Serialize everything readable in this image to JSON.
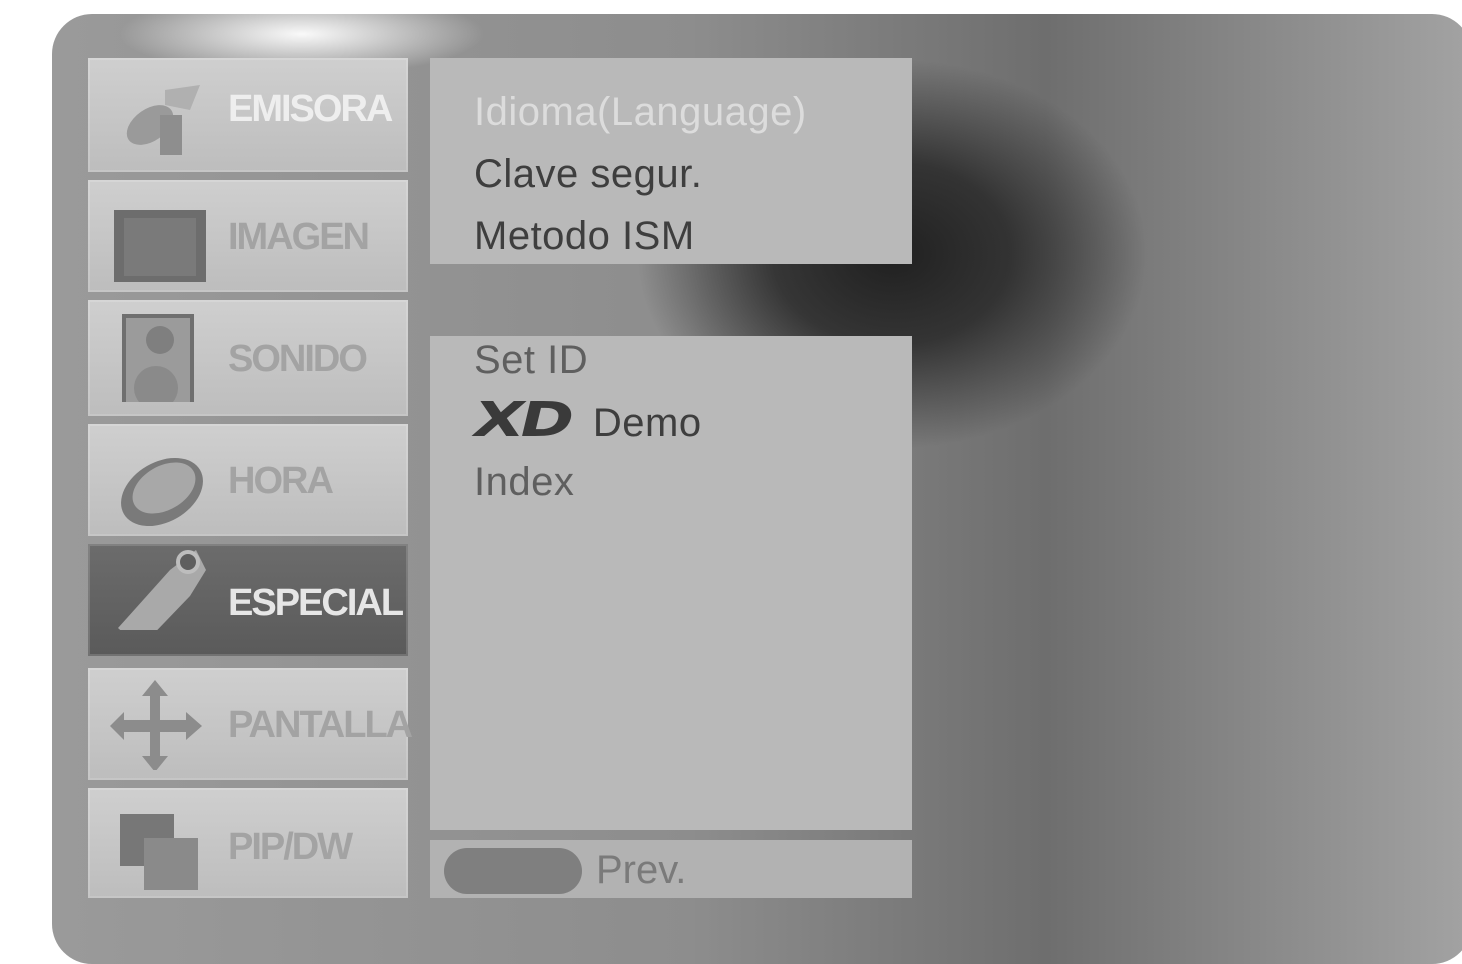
{
  "sidebar": {
    "items": [
      {
        "label": "EMISORA",
        "icon": "satellite-dish-icon"
      },
      {
        "label": "IMAGEN",
        "icon": "picture-icon"
      },
      {
        "label": "SONIDO",
        "icon": "speaker-icon"
      },
      {
        "label": "HORA",
        "icon": "clock-icon"
      },
      {
        "label": "ESPECIAL",
        "icon": "tag-icon",
        "active": true
      },
      {
        "label": "PANTALLA",
        "icon": "move-arrows-icon"
      },
      {
        "label": "PIP/DW",
        "icon": "overlapping-windows-icon"
      }
    ]
  },
  "menu": {
    "top_items": [
      "Idioma(Language)",
      "Clave segur.",
      "Metodo ISM"
    ],
    "lower_items": [
      "Set ID",
      "Demo",
      "Index"
    ],
    "xd_logo": "XD"
  },
  "footer": {
    "prev_label": "Prev."
  },
  "colors": {
    "panel": "#b9b9b9",
    "active_tab": "#5e5e5e",
    "text": "#3e3e3e"
  }
}
